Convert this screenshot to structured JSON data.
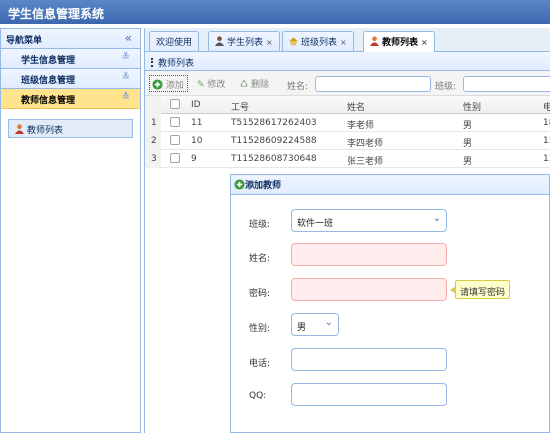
{
  "app": {
    "title": "学生信息管理系统"
  },
  "nav": {
    "header": "导航菜单",
    "sections": [
      {
        "label": "学生信息管理",
        "active": false
      },
      {
        "label": "班级信息管理",
        "active": false
      },
      {
        "label": "教师信息管理",
        "active": true
      }
    ],
    "items": [
      {
        "label": "教师列表",
        "icon": "user-icon"
      }
    ]
  },
  "tabs": [
    {
      "label": "欢迎使用",
      "closable": false,
      "selected": false,
      "icon": ""
    },
    {
      "label": "学生列表",
      "closable": true,
      "selected": false,
      "icon": "user-icon"
    },
    {
      "label": "班级列表",
      "closable": true,
      "selected": false,
      "icon": "home-icon"
    },
    {
      "label": "教师列表",
      "closable": true,
      "selected": true,
      "icon": "user-icon"
    }
  ],
  "panel": {
    "title": "教师列表"
  },
  "toolbar": {
    "add_label": "添加",
    "edit_label": "修改",
    "delete_label": "删除",
    "name_label": "姓名:",
    "class_label": "班级:"
  },
  "table": {
    "columns": [
      "ID",
      "工号",
      "姓名",
      "性别",
      "电"
    ],
    "rows": [
      {
        "rownum": "1",
        "id": "11",
        "number": "T51528617262403",
        "name": "李老师",
        "gender": "男",
        "phone": "18"
      },
      {
        "rownum": "2",
        "id": "10",
        "number": "T11528609224588",
        "name": "李四老师",
        "gender": "男",
        "phone": "13"
      },
      {
        "rownum": "3",
        "id": "9",
        "number": "T11528608730648",
        "name": "张三老师",
        "gender": "男",
        "phone": "13"
      }
    ]
  },
  "dialog": {
    "title": "添加教师",
    "fields": {
      "class_label": "班级:",
      "class_value": "软件一班",
      "name_label": "姓名:",
      "name_value": "",
      "password_label": "密码:",
      "password_value": "",
      "gender_label": "性别:",
      "gender_value": "男",
      "phone_label": "电话:",
      "phone_value": "",
      "qq_label": "QQ:",
      "qq_value": ""
    },
    "tooltip": "请填写密码"
  },
  "colors": {
    "header_bg": "#3b68ae",
    "panel_border": "#95b8e7",
    "active_section": "#ffe48d",
    "error_bg": "#ffecec",
    "tooltip_bg": "#ffffcc"
  }
}
